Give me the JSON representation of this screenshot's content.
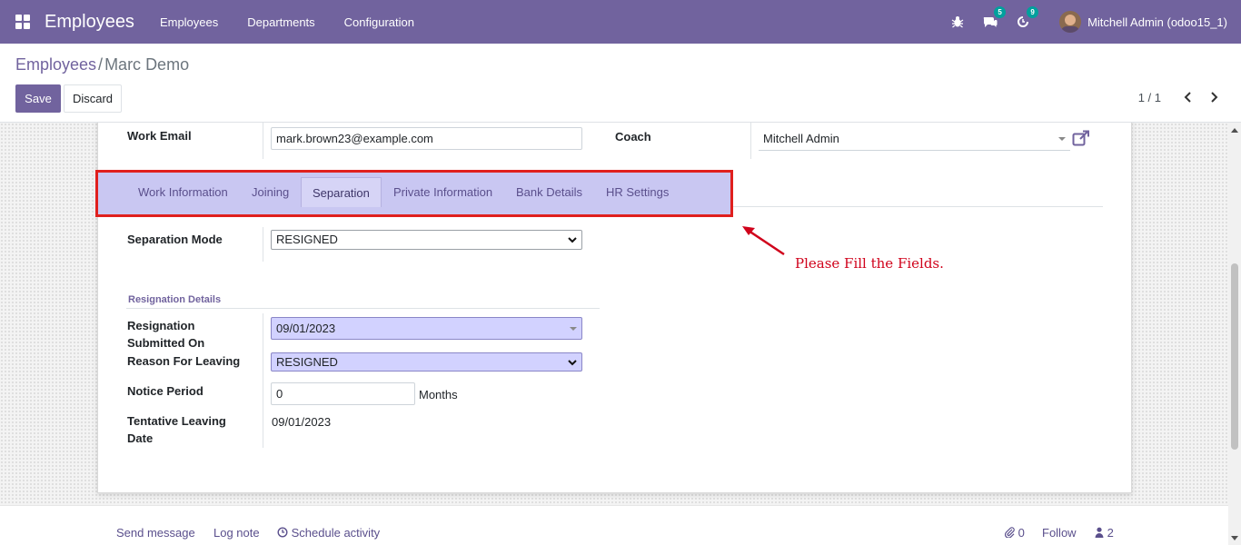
{
  "navbar": {
    "app_title": "Employees",
    "menu": [
      "Employees",
      "Departments",
      "Configuration"
    ],
    "messages_badge": "5",
    "activities_badge": "9",
    "user_name": "Mitchell Admin (odoo15_1)",
    "bg_color": "#71639e"
  },
  "breadcrumb": {
    "parent": "Employees",
    "separator": "/",
    "current": "Marc Demo"
  },
  "actions": {
    "save": "Save",
    "discard": "Discard"
  },
  "pager": {
    "value": "1 / 1"
  },
  "form": {
    "work_email_label": "Work Email",
    "work_email_value": "mark.brown23@example.com",
    "coach_label": "Coach",
    "coach_value": "Mitchell Admin",
    "tabs": [
      "Work Information",
      "Joining",
      "Separation",
      "Private Information",
      "Bank Details",
      "HR Settings"
    ],
    "active_tab": "Separation",
    "separation_mode_label": "Separation Mode",
    "separation_mode_value": "RESIGNED",
    "resignation_section": "Resignation Details",
    "resignation_submitted_label_1": "Resignation",
    "resignation_submitted_label_2": "Submitted On",
    "resignation_submitted_value": "09/01/2023",
    "reason_label": "Reason For Leaving",
    "reason_value": "RESIGNED",
    "notice_label": "Notice Period",
    "notice_value": "0",
    "notice_unit": "Months",
    "tentative_label_1": "Tentative Leaving",
    "tentative_label_2": "Date",
    "tentative_value": "09/01/2023"
  },
  "annotation": {
    "text": "Please Fill the Fields.",
    "color": "#d0021b"
  },
  "chatter": {
    "send_message": "Send message",
    "log_note": "Log note",
    "schedule_activity": "Schedule activity",
    "attachments_count": "0",
    "follow": "Follow",
    "followers_count": "2"
  }
}
